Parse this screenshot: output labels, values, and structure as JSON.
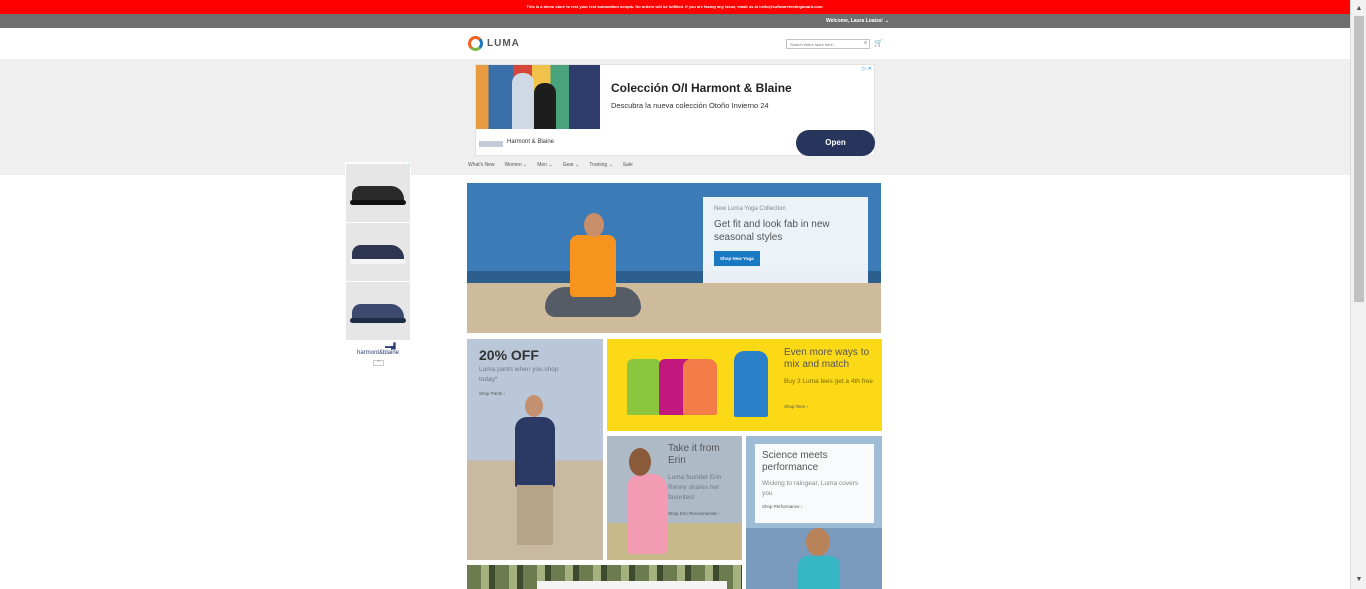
{
  "demo_notice": "This is a demo store to test your test automation scripts. No orders will be fulfilled. If you are facing any issue, email us at hello@softwaretestingboard.com.",
  "header": {
    "welcome": "Welcome, Laura Loaiza!",
    "logo_text": "LUMA",
    "search_placeholder": "Search entire store here..."
  },
  "top_ad": {
    "title": "Colección O/I Harmont & Blaine",
    "subtitle": "Descubra la nueva colección Otoño Invierno 24",
    "brand": "Harmont & Blaine",
    "cta": "Open"
  },
  "nav": {
    "items": [
      "What's New",
      "Women",
      "Men",
      "Gear",
      "Training",
      "Sale"
    ]
  },
  "side_ad": {
    "brand": "harmont&blaine"
  },
  "hero": {
    "eyebrow": "New Luma Yoga Collection",
    "headline": "Get fit and look fab in new seasonal styles",
    "button": "Shop New Yoga"
  },
  "promos": {
    "pants": {
      "big": "20% OFF",
      "text": "Luma pants when you shop today*",
      "link": "Shop Pants"
    },
    "tees": {
      "headline": "Even more ways to mix and match",
      "text": "Buy 3 Luma tees get a 4th free",
      "link": "Shop Tees"
    },
    "erin": {
      "headline": "Take it from Erin",
      "text": "Luma founder Erin Renny shares her favorites!",
      "link": "Shop Erin Recommends"
    },
    "performance": {
      "headline": "Science meets performance",
      "text": "Wicking to raingear, Luma covers you",
      "link": "Shop Performance"
    }
  },
  "colors": {
    "banner": "#ff0000",
    "accent": "#1979c3",
    "tees_bg": "#fcd917"
  }
}
